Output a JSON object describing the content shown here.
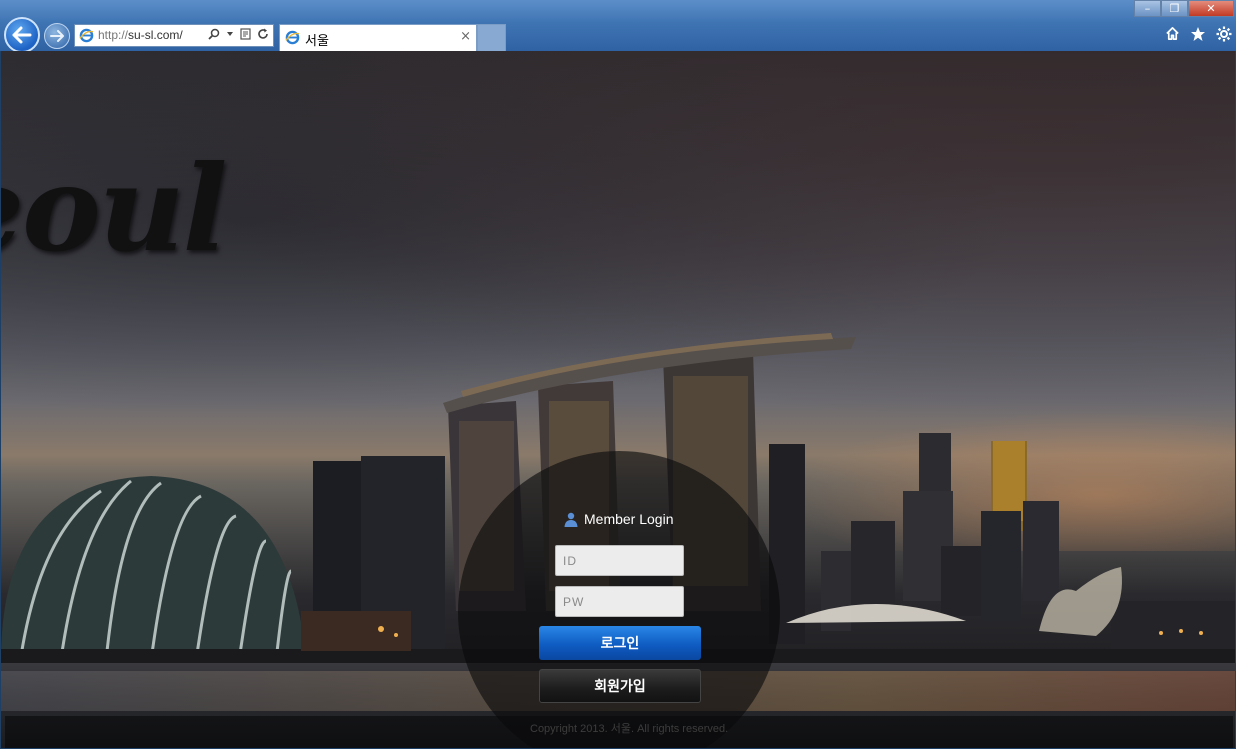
{
  "browser": {
    "url_prefix": "http://",
    "url_domain": "su-sl.com/",
    "tab_title": "서울",
    "tab_close": "×",
    "window_buttons": {
      "minimize": "–",
      "restore": "❐",
      "close": "✕"
    }
  },
  "page": {
    "logo_text": "eoul",
    "login": {
      "title": "Member Login",
      "id_placeholder": "ID",
      "pw_placeholder": "PW",
      "login_button": "로그인",
      "join_button": "회원가입"
    },
    "footer": {
      "copyright": "Copyright 2013. 서울. All rights reserved."
    }
  },
  "colors": {
    "chrome": "#3f74b3",
    "login_button": "#0f5cc3",
    "join_button": "#1c1c1c"
  }
}
